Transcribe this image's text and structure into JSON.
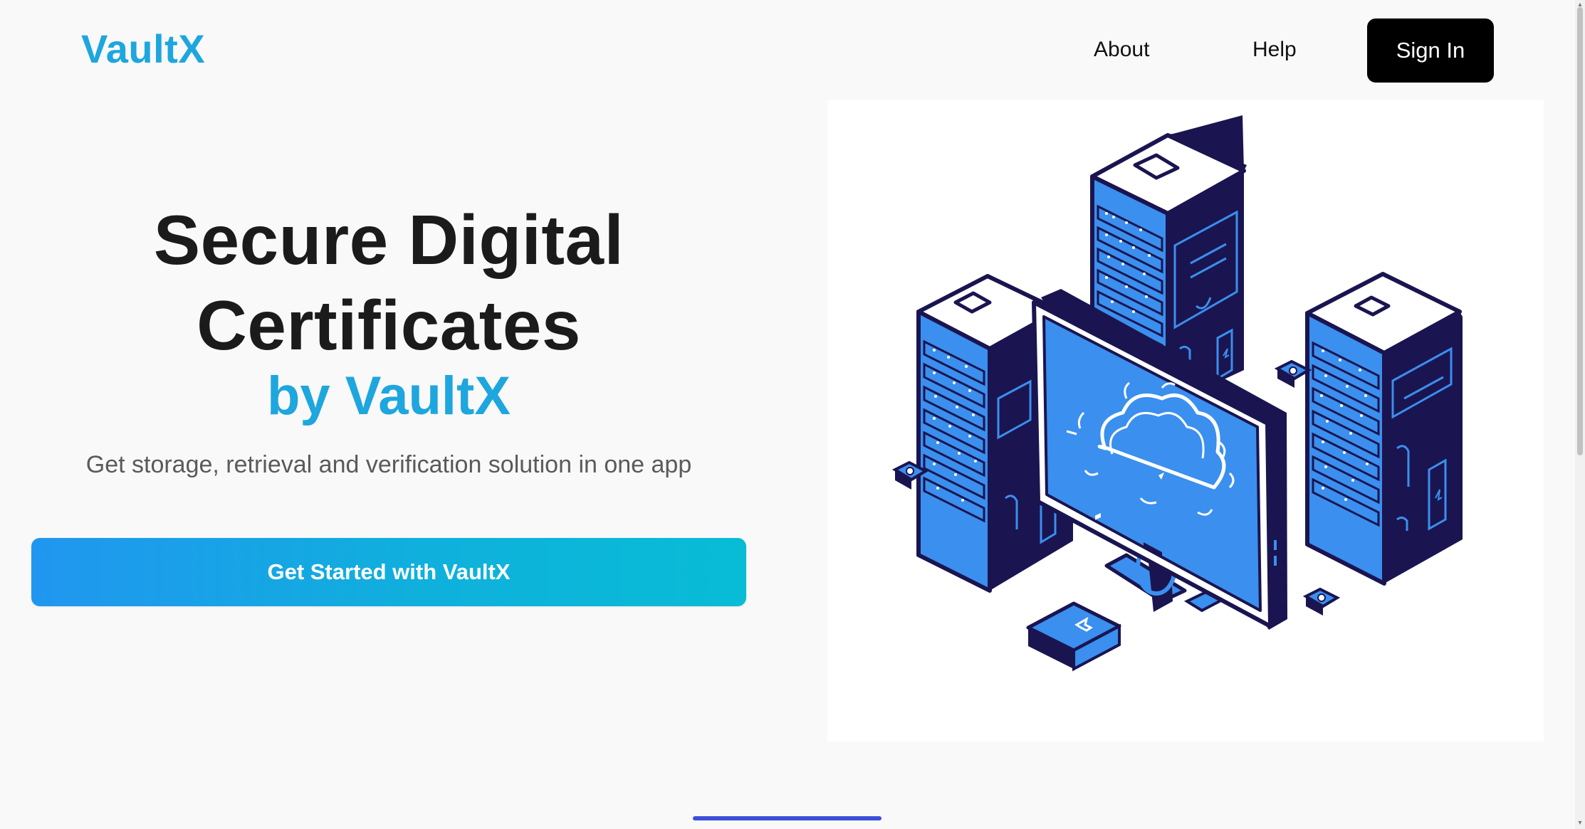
{
  "nav": {
    "logo": "VaultX",
    "links": [
      {
        "label": "About"
      },
      {
        "label": "Help"
      }
    ],
    "signin_label": "Sign In"
  },
  "hero": {
    "title_line1": "Secure Digital",
    "title_line2": "Certificates",
    "brand_line": "by VaultX",
    "description": "Get storage, retrieval and verification solution in one app",
    "cta_label": "Get Started with VaultX"
  },
  "colors": {
    "brand": "#1ea6de",
    "cta_gradient_start": "#2196f0",
    "cta_gradient_end": "#08bcd6",
    "signin_bg": "#000000",
    "illustration_blue": "#3b8fee",
    "illustration_navy": "#1a1550",
    "indicator": "#3d4fd8"
  },
  "illustration": {
    "name": "servers-and-cloud-monitor-illustration"
  }
}
